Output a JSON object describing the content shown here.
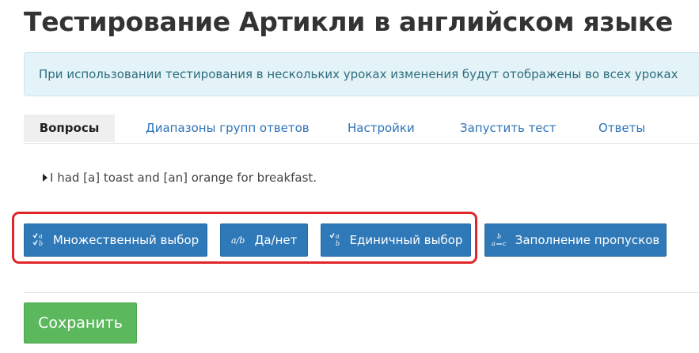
{
  "page": {
    "title": "Тестирование Артикли в английском языке"
  },
  "alert": {
    "text": "При использовании тестирования в нескольких уроках изменения будут отображены во всех уроках"
  },
  "tabs": [
    {
      "label": "Вопросы",
      "active": true
    },
    {
      "label": "Диапазоны групп ответов",
      "active": false
    },
    {
      "label": "Настройки",
      "active": false
    },
    {
      "label": "Запустить тест",
      "active": false
    },
    {
      "label": "Ответы",
      "active": false
    }
  ],
  "question": {
    "text": "I had [a] toast and [an] orange for breakfast.",
    "icon": "caret-right-icon"
  },
  "question_types": [
    {
      "label": "Множественный выбор",
      "icon": "multiple-choice-icon"
    },
    {
      "label": "Да/нет",
      "icon": "yes-no-icon"
    },
    {
      "label": "Единичный выбор",
      "icon": "single-choice-icon"
    },
    {
      "label": "Заполнение пропусков",
      "icon": "fill-blanks-icon"
    }
  ],
  "highlight": {
    "color": "#e0262b",
    "covers": [
      "Множественный выбор",
      "Да/нет",
      "Единичный выбор"
    ]
  },
  "actions": {
    "save_label": "Сохранить"
  },
  "colors": {
    "primary": "#2f79b8",
    "success": "#5cb85c",
    "info_bg": "#e4f3f7",
    "info_text": "#2d6d7e",
    "link": "#2d73b7"
  }
}
